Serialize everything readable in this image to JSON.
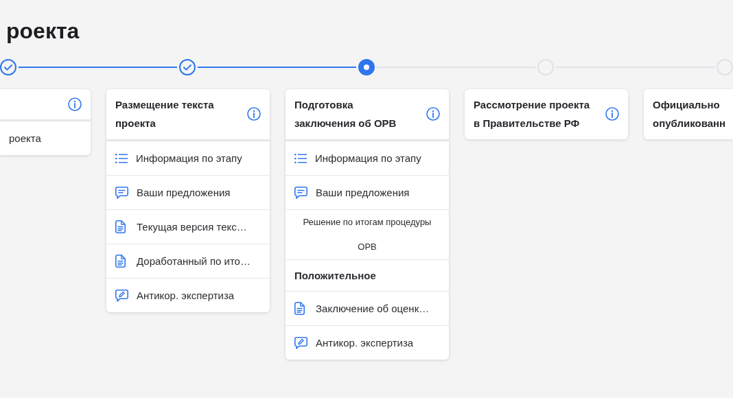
{
  "page": {
    "title": "роекта"
  },
  "stages": [
    {
      "completed": true,
      "current": false,
      "info": true,
      "items": [
        {
          "kind": "plain",
          "label": "роекта"
        }
      ]
    },
    {
      "completed": true,
      "current": false,
      "title": "Размещение текста проекта",
      "info": true,
      "items": [
        {
          "kind": "list",
          "label": "Информация по этапу"
        },
        {
          "kind": "comments",
          "label": "Ваши предложения"
        },
        {
          "kind": "document",
          "label": "Текущая версия текс…"
        },
        {
          "kind": "document",
          "label": "Доработанный по ито…"
        },
        {
          "kind": "expertise",
          "label": "Антикор. экспертиза"
        }
      ]
    },
    {
      "completed": false,
      "current": true,
      "title": "Подготовка заключения об ОРВ",
      "info": true,
      "items": [
        {
          "kind": "list",
          "label": "Информация по этапу"
        },
        {
          "kind": "comments",
          "label": "Ваши предложения"
        },
        {
          "kind": "caption",
          "label": "Решение по итогам процедуры ОРВ"
        },
        {
          "kind": "result",
          "label": "Положительное"
        },
        {
          "kind": "document",
          "label": "Заключение об оценк…"
        },
        {
          "kind": "expertise",
          "label": "Антикор. экспертиза"
        }
      ]
    },
    {
      "completed": false,
      "current": false,
      "title": "Рассмотрение проекта в Правительстве РФ",
      "info": true
    },
    {
      "completed": false,
      "current": false,
      "title": "Официально опубликованн",
      "info": false
    }
  ]
}
